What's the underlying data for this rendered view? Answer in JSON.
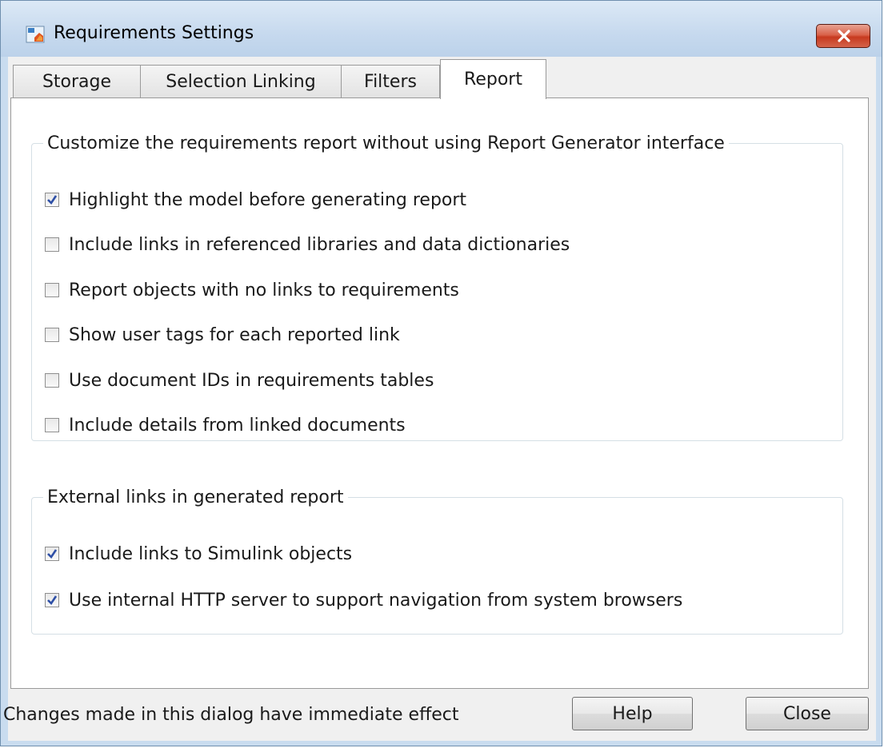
{
  "window": {
    "title": "Requirements Settings",
    "app_icon": "simulink-requirements-icon",
    "close_icon": "close-x-icon",
    "close_color": "#c73a1f"
  },
  "tabs": [
    {
      "label": "Storage",
      "active": false
    },
    {
      "label": "Selection Linking",
      "active": false
    },
    {
      "label": "Filters",
      "active": false
    },
    {
      "label": "Report",
      "active": true
    }
  ],
  "report": {
    "group1": {
      "legend": "Customize the requirements report without using Report Generator interface",
      "options": [
        {
          "label": "Highlight the model before generating report",
          "checked": true
        },
        {
          "label": "Include links in referenced libraries and data dictionaries",
          "checked": false
        },
        {
          "label": "Report objects with no links to requirements",
          "checked": false
        },
        {
          "label": "Show user tags for each reported link",
          "checked": false
        },
        {
          "label": "Use document IDs in requirements tables",
          "checked": false
        },
        {
          "label": "Include details from linked documents",
          "checked": false
        }
      ]
    },
    "group2": {
      "legend": "External links in generated report",
      "options": [
        {
          "label": "Include links to Simulink objects",
          "checked": true
        },
        {
          "label": "Use internal HTTP server to support navigation from system browsers",
          "checked": true
        }
      ]
    }
  },
  "footer": {
    "status": "Changes made in this dialog have immediate effect",
    "help_label": "Help",
    "close_label": "Close"
  }
}
